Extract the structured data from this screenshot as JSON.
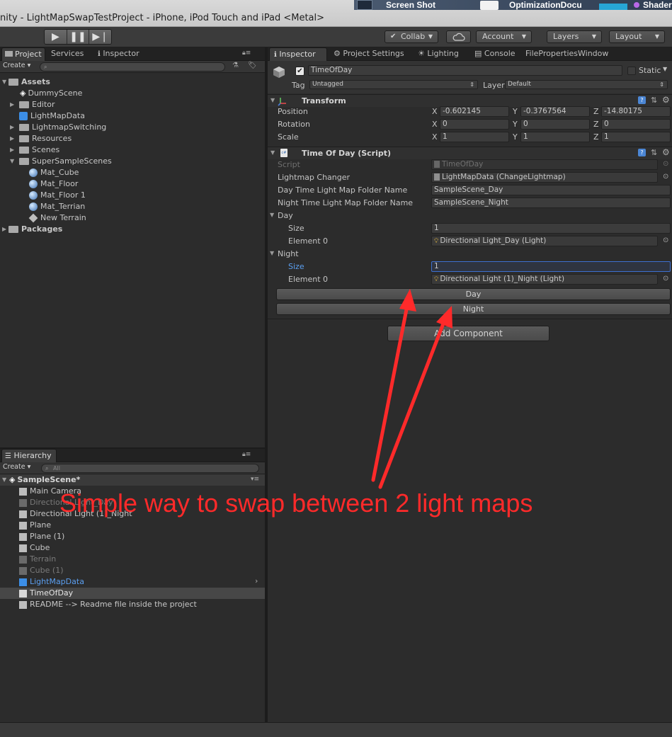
{
  "window": {
    "title": "nity - LightMapSwapTestProject - iPhone, iPod Touch and iPad <Metal>",
    "dock": [
      "Screen Shot",
      "OptimizationDocu",
      "Shader"
    ]
  },
  "toolbar": {
    "collab": "Collab",
    "account": "Account",
    "layers": "Layers",
    "layout": "Layout"
  },
  "project_panel": {
    "tabs": [
      "Project",
      "Services",
      "Inspector"
    ],
    "create": "Create",
    "tree": [
      {
        "label": "Assets",
        "icon": "folder-icon",
        "bold": true
      },
      {
        "label": "DummyScene",
        "icon": "unity-scene-icon"
      },
      {
        "label": "Editor",
        "icon": "folder-icon"
      },
      {
        "label": "LightMapData",
        "icon": "prefab-cube-icon"
      },
      {
        "label": "LightmapSwitching",
        "icon": "folder-icon"
      },
      {
        "label": "Resources",
        "icon": "folder-icon"
      },
      {
        "label": "Scenes",
        "icon": "folder-icon"
      },
      {
        "label": "SuperSampleScenes",
        "icon": "folder-icon"
      },
      {
        "label": "Mat_Cube",
        "icon": "material-sphere-icon"
      },
      {
        "label": "Mat_Floor",
        "icon": "material-sphere-icon"
      },
      {
        "label": "Mat_Floor 1",
        "icon": "material-sphere-icon"
      },
      {
        "label": "Mat_Terrian",
        "icon": "material-sphere-icon"
      },
      {
        "label": "New Terrain",
        "icon": "terrain-icon"
      },
      {
        "label": "Packages",
        "icon": "folder-icon",
        "bold": true
      }
    ]
  },
  "hierarchy_panel": {
    "tab": "Hierarchy",
    "create": "Create",
    "search_placeholder": "All",
    "scene": "SampleScene*",
    "items": [
      {
        "label": "Main Camera",
        "state": "normal"
      },
      {
        "label": "Directional Light_Day",
        "state": "disabled"
      },
      {
        "label": "Directional Light (1)_Night",
        "state": "normal"
      },
      {
        "label": "Plane",
        "state": "normal"
      },
      {
        "label": "Plane (1)",
        "state": "normal"
      },
      {
        "label": "Cube",
        "state": "normal"
      },
      {
        "label": "Terrain",
        "state": "disabled"
      },
      {
        "label": "Cube (1)",
        "state": "disabled"
      },
      {
        "label": "LightMapData",
        "state": "prefab"
      },
      {
        "label": "TimeOfDay",
        "state": "selected"
      },
      {
        "label": "README  -->  Readme file inside the project",
        "state": "normal"
      }
    ]
  },
  "inspector": {
    "tabs": [
      "Inspector",
      "Project Settings",
      "Lighting",
      "Console",
      "FilePropertiesWindow"
    ],
    "object_name": "TimeOfDay",
    "static_label": "Static",
    "tag_label": "Tag",
    "tag_value": "Untagged",
    "layer_label": "Layer",
    "layer_value": "Default",
    "transform": {
      "title": "Transform",
      "rows": [
        {
          "label": "Position",
          "x": "-0.602145",
          "y": "-0.3767564",
          "z": "-14.80175"
        },
        {
          "label": "Rotation",
          "x": "0",
          "y": "0",
          "z": "0"
        },
        {
          "label": "Scale",
          "x": "1",
          "y": "1",
          "z": "1"
        }
      ],
      "axes": [
        "X",
        "Y",
        "Z"
      ]
    },
    "script_component": {
      "title": "Time Of Day (Script)",
      "script_label": "Script",
      "script_value": "TimeOfDay",
      "lightmap_changer_label": "Lightmap Changer",
      "lightmap_changer_value": "LightMapData (ChangeLightmap)",
      "day_folder_label": "Day Time Light Map Folder Name",
      "day_folder_value": "SampleScene_Day",
      "night_folder_label": "Night Time Light Map Folder Name",
      "night_folder_value": "SampleScene_Night",
      "day_label": "Day",
      "day_size_label": "Size",
      "day_size_value": "1",
      "day_element_label": "Element 0",
      "day_element_value": "Directional Light_Day (Light)",
      "night_label": "Night",
      "night_size_label": "Size",
      "night_size_value": "1",
      "night_element_label": "Element 0",
      "night_element_value": "Directional Light (1)_Night (Light)",
      "day_button": "Day",
      "night_button": "Night"
    },
    "add_component": "Add Component"
  },
  "annotation": {
    "text": "Simple way to swap between 2 light maps",
    "color": "#ff2a2a"
  }
}
